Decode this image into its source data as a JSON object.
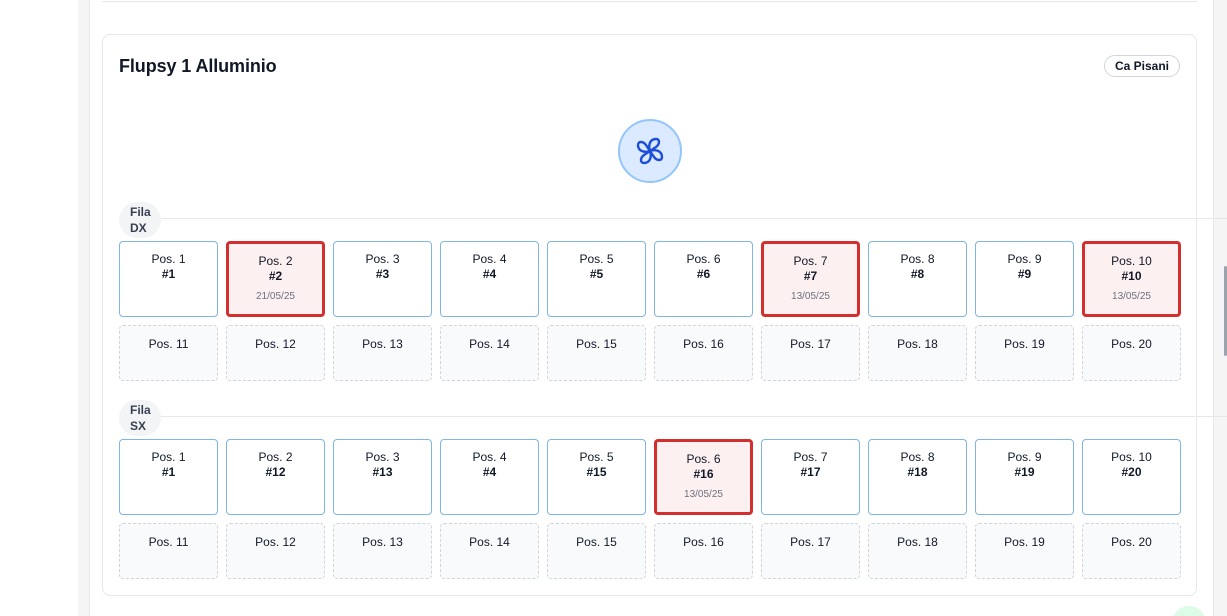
{
  "card": {
    "title": "Flupsy 1 Alluminio",
    "site": "Ca Pisani"
  },
  "rows": [
    {
      "label_line1": "Fila",
      "label_line2": "DX",
      "positions": [
        {
          "pos": "Pos. 1",
          "num": "#1",
          "date": "",
          "alert": false
        },
        {
          "pos": "Pos. 2",
          "num": "#2",
          "date": "21/05/25",
          "alert": true
        },
        {
          "pos": "Pos. 3",
          "num": "#3",
          "date": "",
          "alert": false
        },
        {
          "pos": "Pos. 4",
          "num": "#4",
          "date": "",
          "alert": false
        },
        {
          "pos": "Pos. 5",
          "num": "#5",
          "date": "",
          "alert": false
        },
        {
          "pos": "Pos. 6",
          "num": "#6",
          "date": "",
          "alert": false
        },
        {
          "pos": "Pos. 7",
          "num": "#7",
          "date": "13/05/25",
          "alert": true
        },
        {
          "pos": "Pos. 8",
          "num": "#8",
          "date": "",
          "alert": false
        },
        {
          "pos": "Pos. 9",
          "num": "#9",
          "date": "",
          "alert": false
        },
        {
          "pos": "Pos. 10",
          "num": "#10",
          "date": "13/05/25",
          "alert": true
        }
      ],
      "empty_positions": [
        "Pos. 11",
        "Pos. 12",
        "Pos. 13",
        "Pos. 14",
        "Pos. 15",
        "Pos. 16",
        "Pos. 17",
        "Pos. 18",
        "Pos. 19",
        "Pos. 20"
      ]
    },
    {
      "label_line1": "Fila",
      "label_line2": "SX",
      "positions": [
        {
          "pos": "Pos. 1",
          "num": "#1",
          "date": "",
          "alert": false
        },
        {
          "pos": "Pos. 2",
          "num": "#12",
          "date": "",
          "alert": false
        },
        {
          "pos": "Pos. 3",
          "num": "#13",
          "date": "",
          "alert": false
        },
        {
          "pos": "Pos. 4",
          "num": "#4",
          "date": "",
          "alert": false
        },
        {
          "pos": "Pos. 5",
          "num": "#15",
          "date": "",
          "alert": false
        },
        {
          "pos": "Pos. 6",
          "num": "#16",
          "date": "13/05/25",
          "alert": true
        },
        {
          "pos": "Pos. 7",
          "num": "#17",
          "date": "",
          "alert": false
        },
        {
          "pos": "Pos. 8",
          "num": "#18",
          "date": "",
          "alert": false
        },
        {
          "pos": "Pos. 9",
          "num": "#19",
          "date": "",
          "alert": false
        },
        {
          "pos": "Pos. 10",
          "num": "#20",
          "date": "",
          "alert": false
        }
      ],
      "empty_positions": [
        "Pos. 11",
        "Pos. 12",
        "Pos. 13",
        "Pos. 14",
        "Pos. 15",
        "Pos. 16",
        "Pos. 17",
        "Pos. 18",
        "Pos. 19",
        "Pos. 20"
      ]
    }
  ],
  "icons": {
    "propeller": "propeller-icon"
  },
  "colors": {
    "alert_border": "#d32f2f",
    "alert_bg": "#fdf0f0",
    "cell_border": "#7fb6e3",
    "propeller_bg": "#dbeafe",
    "propeller_stroke": "#1d4ed8"
  }
}
